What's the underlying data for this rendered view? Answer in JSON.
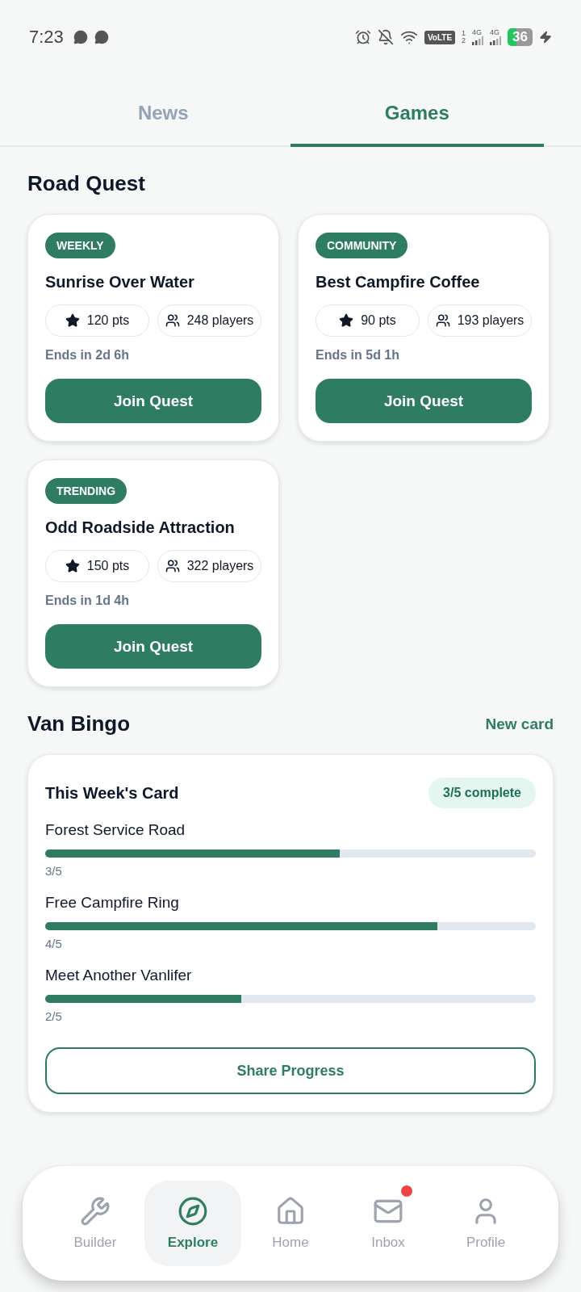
{
  "status_bar": {
    "time": "7:23",
    "volte": "VoLTE",
    "sim_slots": [
      "1",
      "2"
    ],
    "networks": [
      "4G",
      "4G"
    ],
    "battery": "36"
  },
  "tabs": [
    {
      "label": "News",
      "selected": false
    },
    {
      "label": "Games",
      "selected": true
    }
  ],
  "road_quest": {
    "title": "Road Quest",
    "quests": [
      {
        "tag": "WEEKLY",
        "title": "Sunrise Over Water",
        "points": "120 pts",
        "players": "248 players",
        "ends": "Ends in 2d 6h",
        "button": "Join Quest"
      },
      {
        "tag": "COMMUNITY",
        "title": "Best Campfire Coffee",
        "points": "90 pts",
        "players": "193 players",
        "ends": "Ends in 5d 1h",
        "button": "Join Quest"
      },
      {
        "tag": "TRENDING",
        "title": "Odd Roadside Attraction",
        "points": "150 pts",
        "players": "322 players",
        "ends": "Ends in 1d 4h",
        "button": "Join Quest"
      }
    ]
  },
  "van_bingo": {
    "title": "Van Bingo",
    "action": "New card",
    "card": {
      "title": "This Week's Card",
      "badge": "3/5 complete",
      "items": [
        {
          "name": "Forest Service Road",
          "level": 0.6,
          "reading": "3/5"
        },
        {
          "name": "Free Campfire Ring",
          "level": 0.8,
          "reading": "4/5"
        },
        {
          "name": "Meet Another Vanlifer",
          "level": 0.4,
          "reading": "2/5"
        }
      ],
      "button": "Share Progress"
    }
  },
  "bottom_nav": [
    {
      "kind": "builder",
      "label": "Builder",
      "selected": false,
      "badge": false
    },
    {
      "kind": "explore",
      "label": "Explore",
      "selected": true,
      "badge": false
    },
    {
      "kind": "home",
      "label": "Home",
      "selected": false,
      "badge": false
    },
    {
      "kind": "inbox",
      "label": "Inbox",
      "selected": false,
      "badge": true
    },
    {
      "kind": "profile",
      "label": "Profile",
      "selected": false,
      "badge": false
    }
  ]
}
